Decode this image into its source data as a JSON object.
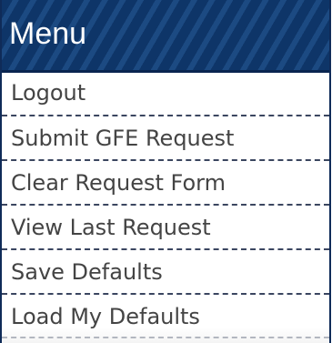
{
  "menu": {
    "title": "Menu",
    "items": [
      {
        "label": "Logout"
      },
      {
        "label": "Submit GFE Request"
      },
      {
        "label": "Clear Request Form"
      },
      {
        "label": "View Last Request"
      },
      {
        "label": "Save Defaults"
      },
      {
        "label": "Load My Defaults"
      }
    ]
  },
  "colors": {
    "header_background": "#0e3568",
    "header_stripe": "#1c4a82",
    "header_text": "#ffffff",
    "item_text": "#444444",
    "divider": "#3b4660"
  }
}
